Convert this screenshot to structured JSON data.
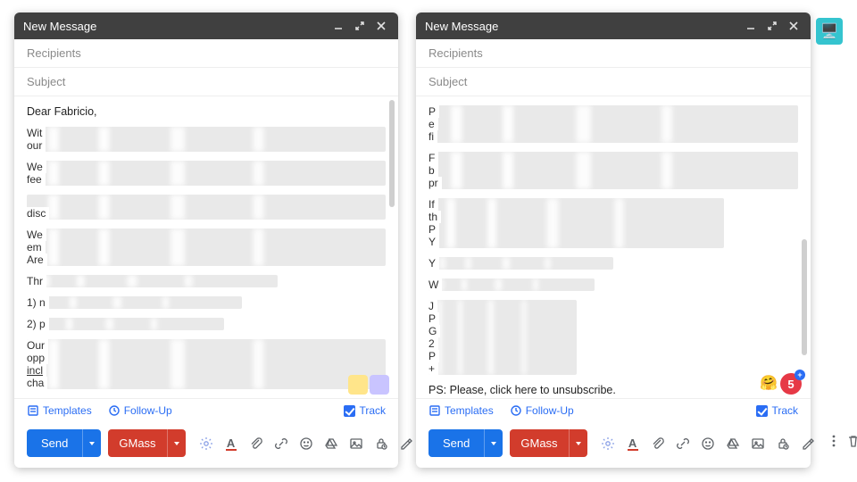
{
  "window": {
    "title": "New Message"
  },
  "fields": {
    "recipients_placeholder": "Recipients",
    "subject_placeholder": "Subject"
  },
  "left_body": {
    "greeting": "Dear Fabricio,",
    "prefixes": {
      "p1a": "Wit",
      "p1b": "our",
      "p2a": "We",
      "p2b": "fee",
      "p3b": "disc",
      "p4a": "We",
      "p4b": "em",
      "p4c": "Are",
      "p5a": "Thr",
      "p6a": "1) n",
      "p7a": "2) p",
      "p8a": "Our",
      "p8b": "opp",
      "p8c": "incl",
      "p8d": "cha"
    }
  },
  "right_body": {
    "prefixes": {
      "p1a": "P",
      "p1b": "e",
      "p1c": "fi",
      "p2a": "F",
      "p2b": "b",
      "p2c": "pr",
      "p3a": "If",
      "p3b": "th",
      "p3c": "P",
      "p3d": "Y",
      "p4a": "Y",
      "p5a": "W",
      "p6a": "J",
      "p6b": "P",
      "p6c": "G",
      "p6d": "2",
      "p6e": "P",
      "p6f": "+"
    },
    "visible_line": "PS: Please, click here to unsubscribe.",
    "badge_count": "5",
    "badge_plus": "+"
  },
  "footer1": {
    "templates": "Templates",
    "followup": "Follow-Up",
    "track": "Track"
  },
  "footer2": {
    "send": "Send",
    "gmass": "GMass"
  },
  "side_widget": {
    "glyph": "🖥️"
  }
}
